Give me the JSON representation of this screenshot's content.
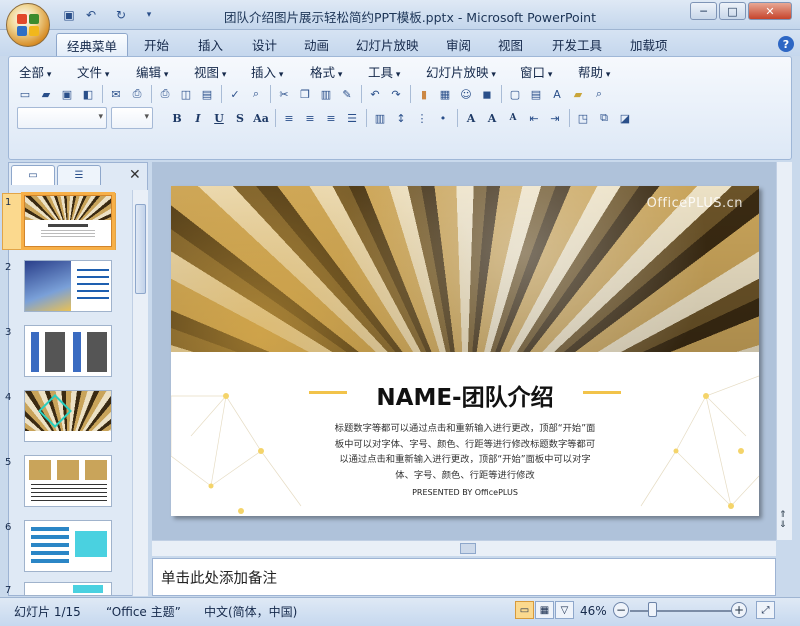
{
  "window": {
    "title": "团队介绍图片展示轻松简约PPT模板.pptx - Microsoft PowerPoint"
  },
  "tabs": [
    "经典菜单",
    "开始",
    "插入",
    "设计",
    "动画",
    "幻灯片放映",
    "审阅",
    "视图",
    "开发工具",
    "加载项"
  ],
  "active_tab": "经典菜单",
  "menus": [
    "全部",
    "文件",
    "编辑",
    "视图",
    "插入",
    "格式",
    "工具",
    "幻灯片放映",
    "窗口",
    "帮助"
  ],
  "thumbnails": [
    "1",
    "2",
    "3",
    "4",
    "5",
    "6",
    "7"
  ],
  "slide": {
    "watermark": "OfficePLUS.cn",
    "title": "NAME-团队介绍",
    "body": "标题数字等都可以通过点击和重新输入进行更改，顶部“开始”面板中可以对字体、字号、颜色、行距等进行修改标题数字等都可以通过点击和重新输入进行更改，顶部“开始”面板中可以对字体、字号、颜色、行距等进行修改",
    "presented": "PRESENTED BY OfficePLUS"
  },
  "notes_placeholder": "单击此处添加备注",
  "status": {
    "slide": "幻灯片 1/15",
    "theme": "“Office 主题”",
    "language": "中文(简体，中国)",
    "zoom": "46%"
  },
  "colors": {
    "accent": "#f2c34a",
    "selection": "#fbd98e"
  }
}
